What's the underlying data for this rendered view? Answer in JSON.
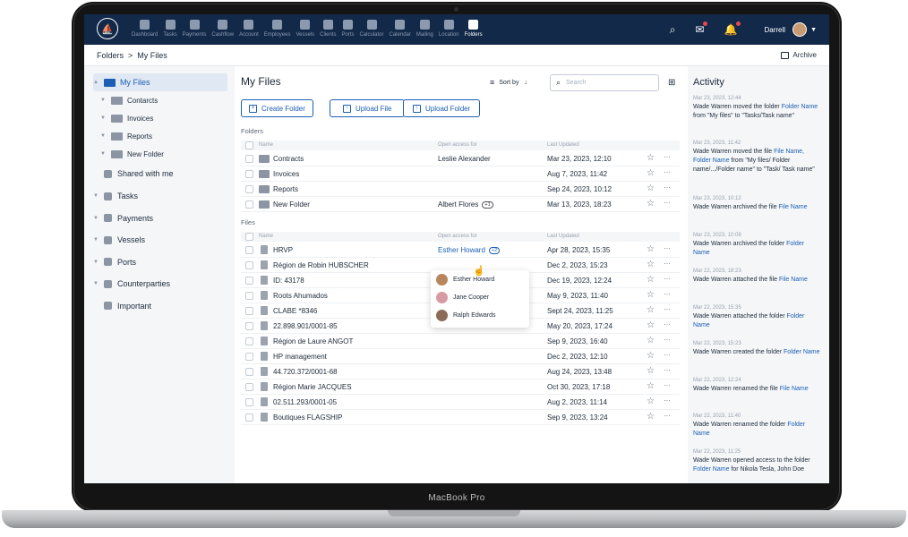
{
  "device_label": "MacBook Pro",
  "nav": {
    "items": [
      "Dashboard",
      "Tasks",
      "Payments",
      "Cashflow",
      "Account",
      "Employees",
      "Vessels",
      "Clients",
      "Ports",
      "Calculator",
      "Calendar",
      "Mailing",
      "Location",
      "Folders"
    ],
    "active": "Folders",
    "user": "Darrell",
    "icons": [
      "search-icon",
      "mail-icon",
      "bell-icon"
    ]
  },
  "breadcrumb": {
    "root": "Folders",
    "sep": ">",
    "current": "My Files"
  },
  "archive_label": "Archive",
  "sidebar": {
    "my_files": "My Files",
    "subfolders": [
      "Contarcts",
      "Invoices",
      "Reports",
      "New Folder"
    ],
    "shared": "Shared with me",
    "sections": [
      "Tasks",
      "Payments",
      "Vessels",
      "Ports",
      "Counterparties",
      "Important"
    ]
  },
  "main": {
    "title": "My Files",
    "sort_label": "Sort by",
    "search_placeholder": "Search",
    "buttons": {
      "create_folder": "Create Folder",
      "upload_file": "Upload File",
      "upload_folder": "Upload Folder"
    },
    "folders_label": "Folders",
    "files_label": "Files",
    "columns": {
      "name": "Name",
      "access": "Open access for",
      "updated": "Last Updated"
    },
    "folders": [
      {
        "name": "Contracts",
        "access": "Leslie Alexander",
        "plus": "",
        "updated": "Mar 23, 2023, 12:10"
      },
      {
        "name": "Invoices",
        "access": "",
        "plus": "",
        "updated": "Aug 7, 2023, 11:42"
      },
      {
        "name": "Reports",
        "access": "",
        "plus": "",
        "updated": "Sep 24, 2023, 10:12"
      },
      {
        "name": "New Folder",
        "access": "Albert Flores",
        "plus": "+1",
        "updated": "Mar 13, 2023, 18:23"
      }
    ],
    "files": [
      {
        "name": "HRVP",
        "access": "Esther Howard",
        "plus": "+2",
        "updated": "Apr 28, 2023, 15:35"
      },
      {
        "name": "Région de Robin HUBSCHER",
        "access": "",
        "plus": "",
        "updated": "Dec 2, 2023, 15:23"
      },
      {
        "name": "ID: 43178",
        "access": "",
        "plus": "",
        "updated": "Dec 19, 2023, 12:24"
      },
      {
        "name": "Roots Ahumados",
        "access": "",
        "plus": "",
        "updated": "May 9, 2023, 11:40"
      },
      {
        "name": "CLABE *8346",
        "access": "",
        "plus": "",
        "updated": "Sept 24, 2023, 11:25"
      },
      {
        "name": "22.898.901/0001-85",
        "access": "",
        "plus": "",
        "updated": "May 20, 2023, 17:24"
      },
      {
        "name": "Région de Laure ANGOT",
        "access": "",
        "plus": "",
        "updated": "Sep 9, 2023, 16:40"
      },
      {
        "name": "HP management",
        "access": "",
        "plus": "",
        "updated": "Dec 2, 2023, 12:10"
      },
      {
        "name": "44.720.372/0001-68",
        "access": "",
        "plus": "",
        "updated": "Aug 24, 2023, 13:48"
      },
      {
        "name": "Région Marie JACQUES",
        "access": "",
        "plus": "",
        "updated": "Oct 30, 2023, 17:18"
      },
      {
        "name": "02.511.293/0001-05",
        "access": "",
        "plus": "",
        "updated": "Aug 2, 2023, 11:14"
      },
      {
        "name": "Boutiques FLAGSHIP",
        "access": "",
        "plus": "",
        "updated": "Sep 9, 2023, 13:24"
      }
    ],
    "popup_people": [
      "Esther Howard",
      "Jane Cooper",
      "Ralph Edwards"
    ]
  },
  "activity": {
    "title": "Activity",
    "entries": [
      {
        "time": "Mar 23, 2023, 12:44",
        "parts": [
          [
            "Wade Warren moved the folder ",
            ""
          ],
          [
            "Folder Name",
            "link"
          ],
          [
            " from \"My files\" to \"Tasks/Task name\"",
            ""
          ]
        ]
      },
      {
        "time": "Mar 23, 2023, 11:42",
        "parts": [
          [
            "Wade Warren moved the file ",
            ""
          ],
          [
            "File Name, Folder Name",
            "link"
          ],
          [
            " from \"My files/ Folder name/.../Folder name\" to \"Task/ Task name\"",
            ""
          ]
        ]
      },
      {
        "time": "Mar 23, 2023, 10:12",
        "parts": [
          [
            "Wade Warren archived the file ",
            ""
          ],
          [
            "File Name",
            "link"
          ]
        ]
      },
      {
        "time": "Mar 23, 2023, 10:09",
        "parts": [
          [
            "Wade Warren archived the folder ",
            ""
          ],
          [
            "Folder Name",
            "link"
          ]
        ]
      },
      {
        "time": "Mar 22, 2023, 18:23",
        "parts": [
          [
            "Wade Warren attached the file ",
            ""
          ],
          [
            "File Name",
            "link"
          ]
        ]
      },
      {
        "time": "Mar 22, 2023, 15:35",
        "parts": [
          [
            "Wade Warren attached the folder ",
            ""
          ],
          [
            "Folder Name",
            "link"
          ]
        ]
      },
      {
        "time": "Mar 22, 2023, 15:23",
        "parts": [
          [
            "Wade Warren created the folder ",
            ""
          ],
          [
            "Folder Name",
            "link"
          ]
        ]
      },
      {
        "time": "Mar 22, 2023, 12:24",
        "parts": [
          [
            "Wade Warren renamed the file ",
            ""
          ],
          [
            "File Name",
            "link"
          ]
        ]
      },
      {
        "time": "Mar 22, 2023, 11:40",
        "parts": [
          [
            "Wade Warren renamed the folder ",
            ""
          ],
          [
            "Folder Name",
            "link"
          ]
        ]
      },
      {
        "time": "Mar 22, 2023, 11:25",
        "parts": [
          [
            "Wade Warren opened access to the folder ",
            ""
          ],
          [
            "Folder Name",
            "link"
          ],
          [
            " for Nikola Tesla, John Doe",
            ""
          ]
        ]
      }
    ]
  }
}
